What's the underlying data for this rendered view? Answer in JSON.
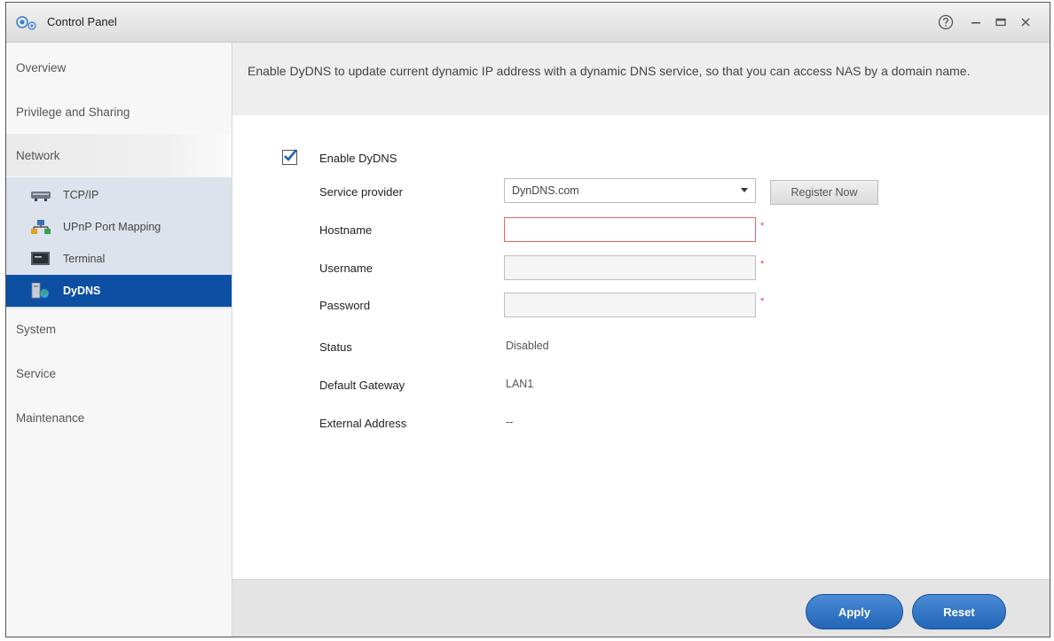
{
  "window": {
    "title": "Control Panel"
  },
  "sidebar": {
    "items": [
      {
        "label": "Overview"
      },
      {
        "label": "Privilege and Sharing"
      },
      {
        "label": "Network"
      },
      {
        "label": "System"
      },
      {
        "label": "Service"
      },
      {
        "label": "Maintenance"
      }
    ],
    "network_sub": [
      {
        "label": "TCP/IP",
        "icon": "network-card-icon"
      },
      {
        "label": "UPnP Port Mapping",
        "icon": "upnp-network-icon"
      },
      {
        "label": "Terminal",
        "icon": "terminal-icon"
      },
      {
        "label": "DyDNS",
        "icon": "dydns-globe-icon",
        "active": true
      }
    ]
  },
  "main": {
    "description": "Enable DyDNS to update current dynamic IP address with a dynamic DNS service, so that you can access NAS by a domain name.",
    "enable_label": "Enable DyDNS",
    "enable_checked": true,
    "service_provider_label": "Service provider",
    "service_provider_value": "DynDNS.com",
    "register_button": "Register Now",
    "hostname_label": "Hostname",
    "hostname_value": "",
    "username_label": "Username",
    "username_value": "",
    "password_label": "Password",
    "password_value": "",
    "required_mark": "*",
    "status_label": "Status",
    "status_value": "Disabled",
    "gateway_label": "Default Gateway",
    "gateway_value": "LAN1",
    "external_label": "External Address",
    "external_value": "--"
  },
  "footer": {
    "apply": "Apply",
    "reset": "Reset"
  },
  "colors": {
    "accent": "#0c4fa3",
    "button": "#2f72c4",
    "required": "#e0443c"
  }
}
